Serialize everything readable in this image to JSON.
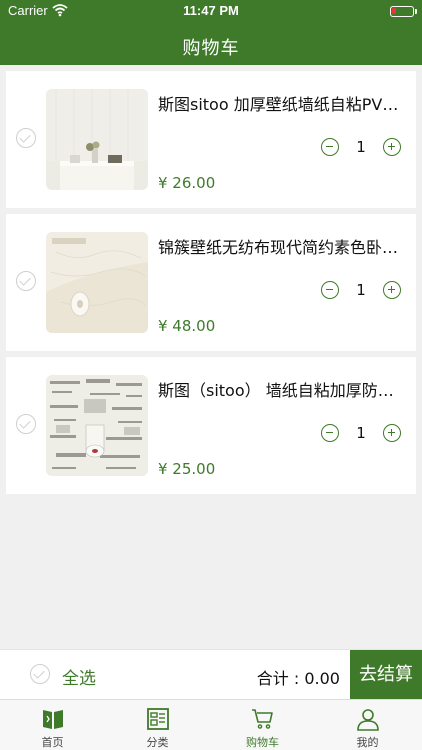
{
  "status": {
    "carrier": "Carrier",
    "time": "11:47 PM"
  },
  "header": {
    "title": "购物车"
  },
  "cart": {
    "items": [
      {
        "name": "斯图sitoo 加厚壁纸墙纸自粘PVC防水卧室客厅",
        "qty": "1",
        "price": "¥ 26.00"
      },
      {
        "name": "锦簇壁纸无纺布现代简约素色卧室客厅背景墙",
        "qty": "1",
        "price": "¥ 48.00"
      },
      {
        "name": "斯图（sitoo） 墙纸自粘加厚防水墙贴报纸",
        "qty": "1",
        "price": "¥ 25.00"
      }
    ]
  },
  "footer": {
    "select_all": "全选",
    "total": "合计 : 0.00",
    "checkout": "去结算"
  },
  "tabs": [
    {
      "label": "首页",
      "icon": "home-book-icon"
    },
    {
      "label": "分类",
      "icon": "category-icon"
    },
    {
      "label": "购物车",
      "icon": "cart-icon"
    },
    {
      "label": "我的",
      "icon": "profile-icon"
    }
  ],
  "colors": {
    "accent": "#3f7a2a",
    "background": "#f0f0f0"
  }
}
